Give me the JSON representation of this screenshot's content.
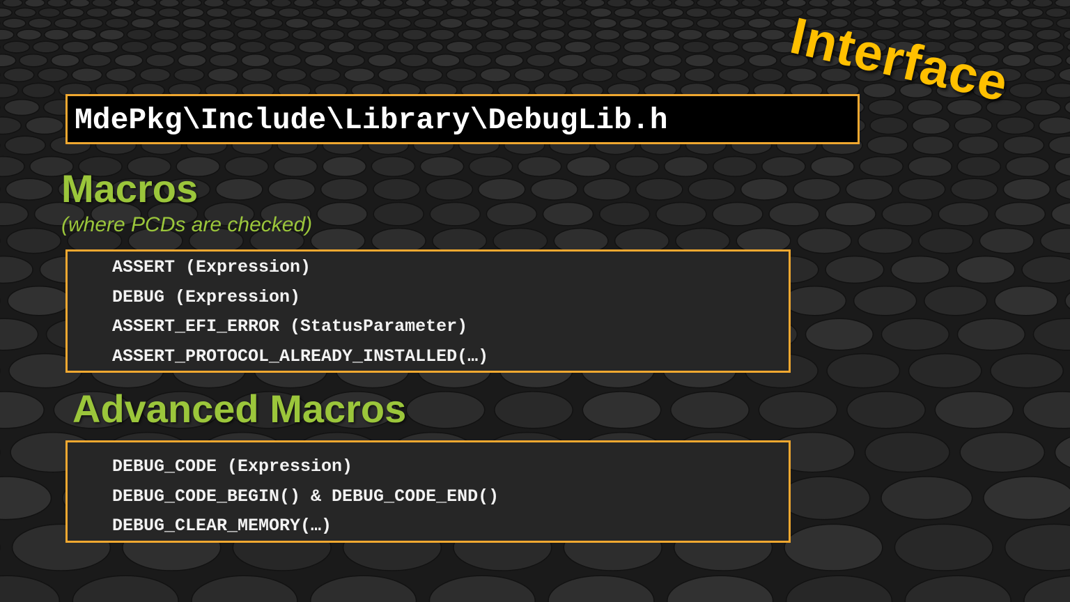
{
  "slide": {
    "title": "Interface",
    "path": "MdePkg\\Include\\Library\\DebugLib.h",
    "macros_heading": "Macros",
    "macros_subtitle": "(where PCDs are checked)",
    "macros": [
      "ASSERT (Expression)",
      "DEBUG (Expression)",
      "ASSERT_EFI_ERROR (StatusParameter)",
      "ASSERT_PROTOCOL_ALREADY_INSTALLED(…)"
    ],
    "advanced_heading": "Advanced Macros",
    "advanced_macros": [
      "DEBUG_CODE (Expression)",
      "DEBUG_CODE_BEGIN() & DEBUG_CODE_END()",
      "DEBUG_CLEAR_MEMORY(…)"
    ]
  },
  "colors": {
    "title": "#ffc000",
    "heading": "#9bc63b",
    "box_border": "#f0a830",
    "background": "#2a2a2a"
  }
}
